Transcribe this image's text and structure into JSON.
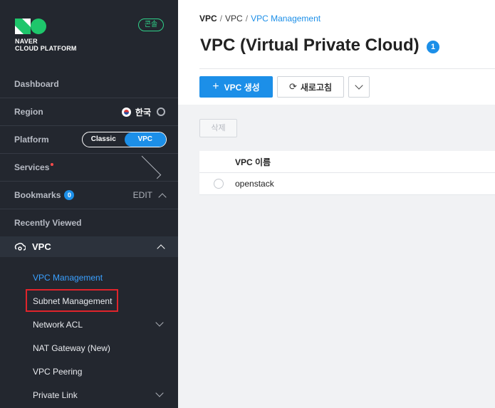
{
  "sidebar": {
    "brand": {
      "line1": "NAVER",
      "line2": "CLOUD PLATFORM",
      "console_label": "콘솔"
    },
    "dashboard": "Dashboard",
    "region": {
      "label": "Region",
      "value": "한국"
    },
    "platform": {
      "label": "Platform",
      "options": [
        "Classic",
        "VPC"
      ],
      "active": "VPC"
    },
    "services": "Services",
    "bookmarks": {
      "label": "Bookmarks",
      "count": "0",
      "edit": "EDIT"
    },
    "recently_viewed": "Recently Viewed",
    "vpc_section": {
      "label": "VPC",
      "items": [
        {
          "label": "VPC Management"
        },
        {
          "label": "Subnet Management"
        },
        {
          "label": "Network ACL"
        },
        {
          "label": "NAT Gateway (New)"
        },
        {
          "label": "VPC Peering"
        },
        {
          "label": "Private Link"
        }
      ]
    }
  },
  "main": {
    "breadcrumb": [
      "VPC",
      "VPC",
      "VPC Management"
    ],
    "title": "VPC (Virtual Private Cloud)",
    "title_count": "1",
    "toolbar": {
      "create_label": "VPC 생성",
      "refresh_label": "새로고침"
    },
    "delete_label": "삭제",
    "table": {
      "header": "VPC 이름",
      "rows": [
        {
          "name": "openstack"
        }
      ]
    }
  },
  "colors": {
    "accent": "#1c8fe8",
    "sidebar_bg": "#23272f",
    "highlight": "#e0242b",
    "console_green": "#2fd28a"
  }
}
